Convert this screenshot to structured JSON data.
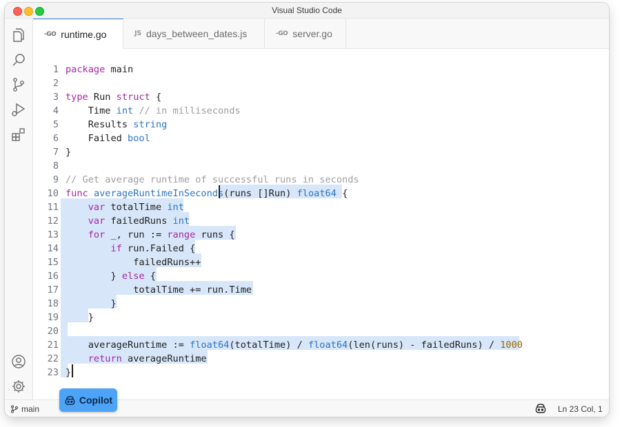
{
  "window": {
    "title": "Visual Studio Code"
  },
  "activity_bar": {
    "items": [
      "explorer-icon",
      "search-icon",
      "source-control-icon",
      "run-debug-icon",
      "extensions-icon"
    ],
    "bottom": [
      "account-icon",
      "settings-gear-icon"
    ]
  },
  "tabs": [
    {
      "icon": "-GO",
      "label": "runtime.go",
      "active": true
    },
    {
      "icon": "JS",
      "label": "days_between_dates.js",
      "active": false
    },
    {
      "icon": "-GO",
      "label": "server.go",
      "active": false
    }
  ],
  "editor": {
    "line_numbers": [
      "1",
      "2",
      "3",
      "4",
      "5",
      "6",
      "7",
      "8",
      "9",
      "10",
      "11",
      "12",
      "13",
      "14",
      "15",
      "16",
      "17",
      "18",
      "19",
      "20",
      "21",
      "22",
      "23"
    ],
    "lines": [
      "package main",
      "",
      "type Run struct {",
      "    Time int // in milliseconds",
      "    Results string",
      "    Failed bool",
      "}",
      "",
      "// Get average runtime of successful runs in seconds",
      "func averageRuntimeInSeconds(runs []Run) float64 {",
      "    var totalTime int",
      "    var failedRuns int",
      "    for _, run := range runs {",
      "        if run.Failed {",
      "            failedRuns++",
      "        } else {",
      "            totalTime += run.Time",
      "        }",
      "    }",
      "",
      "    averageRuntime := float64(totalTime) / float64(len(runs) - failedRuns) / 1000",
      "    return averageRuntime",
      "}"
    ]
  },
  "status_bar": {
    "branch": "main",
    "cursor_position": "Ln 23 Col, 1"
  },
  "copilot": {
    "label": "Copilot"
  },
  "colors": {
    "accent": "#2a7de1",
    "selection": "#d7e6f8",
    "keyword": "#a626a4",
    "type": "#2f74c0",
    "comment": "#9e9e9e",
    "copilot_badge": "#4da3f5"
  }
}
